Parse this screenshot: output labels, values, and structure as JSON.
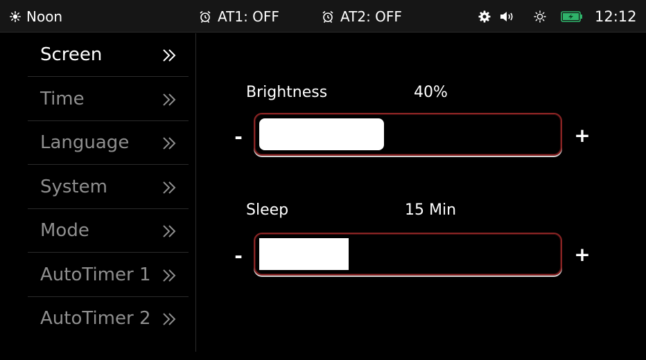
{
  "status_bar": {
    "daypart_icon": "sun-icon",
    "daypart": "Noon",
    "alarm1": {
      "icon": "alarm-clock-icon",
      "label": "AT1: OFF"
    },
    "alarm2": {
      "icon": "alarm-clock-icon",
      "label": "AT2: OFF"
    },
    "icons": [
      "gear-icon",
      "speaker-icon",
      "brightness-icon",
      "battery-icon"
    ],
    "battery_color": "#2fb36a",
    "time": "12:12"
  },
  "sidebar": {
    "items": [
      {
        "label": "Screen",
        "active": true
      },
      {
        "label": "Time",
        "active": false
      },
      {
        "label": "Language",
        "active": false
      },
      {
        "label": "System",
        "active": false
      },
      {
        "label": "Mode",
        "active": false
      },
      {
        "label": "AutoTimer 1",
        "active": false
      },
      {
        "label": "AutoTimer 2",
        "active": false
      }
    ],
    "chevron_icon": "double-chevron-right-icon"
  },
  "settings": {
    "brightness": {
      "label": "Brightness",
      "value": "40%",
      "level": 0.42,
      "minus": "-",
      "plus": "+"
    },
    "sleep": {
      "label": "Sleep",
      "value": "15 Min",
      "level": 0.3,
      "minus": "-",
      "plus": "+"
    }
  },
  "colors": {
    "background": "#000000",
    "status_bar": "#161616",
    "track_border": "#8a2424",
    "active_text": "#ffffff",
    "inactive_text": "#8f8f8f"
  }
}
